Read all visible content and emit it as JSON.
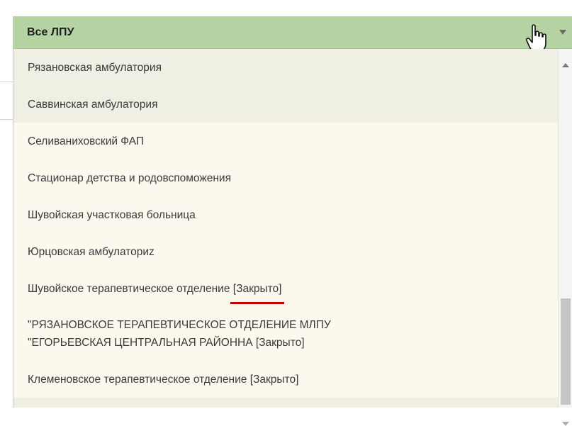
{
  "dropdown": {
    "selected": "Все ЛПУ",
    "items": [
      {
        "label": "Рязановская амбулатория",
        "closed": ""
      },
      {
        "label": "Саввинская амбулатория",
        "closed": ""
      },
      {
        "label": "Селиваниховский ФАП",
        "closed": ""
      },
      {
        "label": "Стационар детства и родовспоможения",
        "closed": ""
      },
      {
        "label": "Шувойская участковая больница",
        "closed": ""
      },
      {
        "label": "Юрцовская амбулаториz",
        "closed": ""
      },
      {
        "label": "Шувойское терапевтическое отделение",
        "closed": "[Закрыто]"
      },
      {
        "label_line1": "\"РЯЗАНОВСКОЕ ТЕРАПЕВТИЧЕСКОЕ ОТДЕЛЕНИЕ МЛПУ",
        "label_line2": "\"ЕГОРЬЕВСКАЯ ЦЕНТРАЛЬНАЯ РАЙОННА",
        "closed": "[Закрыто]"
      },
      {
        "label": "Клеменовское терапевтическое отделение",
        "closed": "[Закрыто]"
      }
    ]
  },
  "colors": {
    "header_bg": "#b5d3a3",
    "list_bg": "#f0efe3",
    "highlight_underline": "#c40000"
  }
}
